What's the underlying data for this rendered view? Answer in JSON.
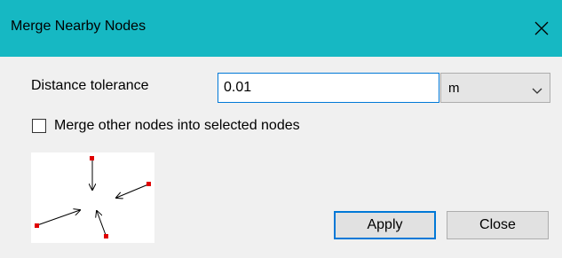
{
  "window": {
    "title": "Merge Nearby Nodes",
    "close_icon": "close-icon",
    "titlebar_color": "#16b8c3"
  },
  "form": {
    "distance_label": "Distance tolerance",
    "distance_value": "0.01",
    "unit_value": "m",
    "unit_icon": "chevron-down-icon",
    "merge_checkbox_label": "Merge other nodes into selected nodes",
    "merge_checkbox_checked": false
  },
  "diagram": {
    "icon": "merge-nodes-diagram",
    "node_color": "#e00000"
  },
  "buttons": {
    "apply_label": "Apply",
    "close_label": "Close",
    "focus_color": "#0078d7"
  }
}
